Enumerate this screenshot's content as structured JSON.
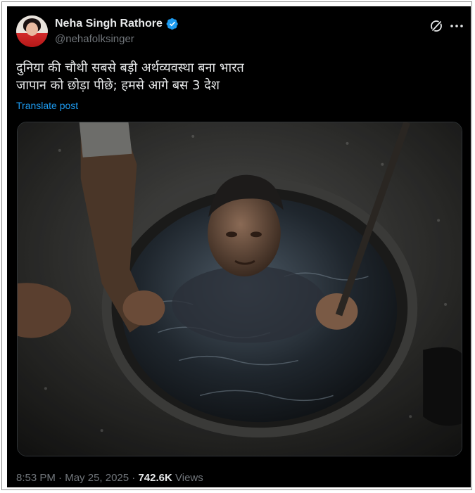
{
  "author": {
    "display_name": "Neha Singh Rathore",
    "handle": "@nehafolksinger",
    "verified": true
  },
  "post": {
    "text_lines": [
      "दुनिया की चौथी सबसे बड़ी अर्थव्यवस्था बना भारत",
      "जापान को छोड़ा पीछे; हमसे आगे बस 3 देश"
    ],
    "translate_label": "Translate post"
  },
  "meta": {
    "time": "8:53 PM",
    "separator": " · ",
    "date": "May 25, 2025",
    "views_count": "742.6K",
    "views_label": " Views"
  },
  "icons": {
    "grok": "grok-icon",
    "more": "more-icon",
    "verified": "verified-badge-icon"
  },
  "colors": {
    "background": "#000000",
    "primary_text": "#e7e9ea",
    "secondary_text": "#71767b",
    "link": "#1d9bf0",
    "verified": "#1d9bf0"
  }
}
